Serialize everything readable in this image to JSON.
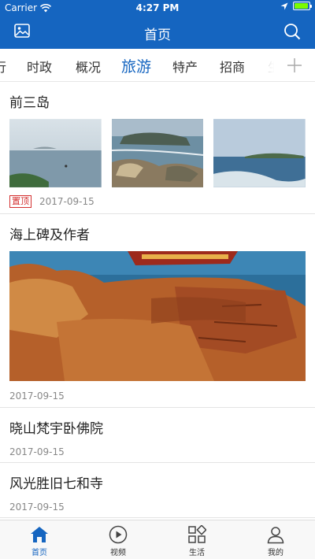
{
  "status": {
    "carrier": "Carrier",
    "time": "4:27 PM",
    "battery_level": 0.95
  },
  "header": {
    "title": "首页",
    "left_icon": "image-icon",
    "right_icon": "search-icon"
  },
  "tabs": [
    {
      "label": "行",
      "active": false
    },
    {
      "label": "时政",
      "active": false
    },
    {
      "label": "概况",
      "active": false
    },
    {
      "label": "旅游",
      "active": true
    },
    {
      "label": "特产",
      "active": false
    },
    {
      "label": "招商",
      "active": false
    },
    {
      "label": "生",
      "active": false
    }
  ],
  "feed": [
    {
      "title": "前三岛",
      "tag": "置顶",
      "date": "2017-09-15"
    },
    {
      "title": "海上碑及作者",
      "date": "2017-09-15"
    },
    {
      "title": "晓山梵宇卧佛院",
      "date": "2017-09-15"
    },
    {
      "title": "风光胜旧七和寺",
      "date": "2017-09-15"
    }
  ],
  "tabbar": [
    {
      "label": "首页",
      "icon": "home-icon",
      "active": true
    },
    {
      "label": "视频",
      "icon": "play-icon",
      "active": false
    },
    {
      "label": "生活",
      "icon": "grid-icon",
      "active": false
    },
    {
      "label": "我的",
      "icon": "user-icon",
      "active": false
    }
  ],
  "colors": {
    "brand": "#1565c0",
    "tag": "#d32f2f"
  }
}
